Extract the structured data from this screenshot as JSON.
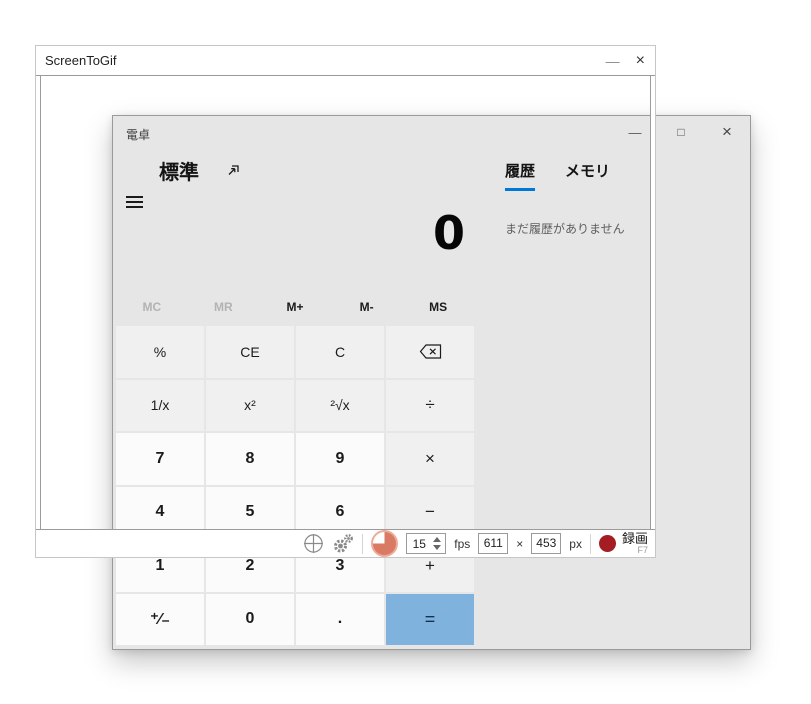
{
  "screentogif": {
    "title": "ScreenToGif",
    "controls": {
      "minimize": "—",
      "close": "×"
    },
    "toolbar": {
      "fps_value": "15",
      "fps_label": "fps",
      "width_value": "611",
      "dimension_separator": "×",
      "height_value": "453",
      "px_label": "px",
      "record_label": "録画",
      "record_shortcut": "F7"
    },
    "icons": {
      "crosshair": "crosshair-target-circle",
      "settings": "double-gears",
      "delay": "salmon-pie-three-quarters",
      "record": "dark-red-filled-dot"
    }
  },
  "calculator": {
    "title": "電卓",
    "controls": {
      "minimize": "—",
      "maximize": "□",
      "close": "×"
    },
    "mode_label": "標準",
    "icons": {
      "keep_on_top": "box-with-diagonal-arrow",
      "menu": "hamburger-three-lines",
      "backspace": "tag-with-x"
    },
    "tabs": [
      {
        "label": "履歴",
        "active": true
      },
      {
        "label": "メモリ",
        "active": false
      }
    ],
    "history_empty_text": "まだ履歴がありません",
    "display_value": "0",
    "memory_buttons": [
      {
        "label": "MC",
        "enabled": false
      },
      {
        "label": "MR",
        "enabled": false
      },
      {
        "label": "M+",
        "enabled": true
      },
      {
        "label": "M-",
        "enabled": true
      },
      {
        "label": "MS",
        "enabled": true
      }
    ],
    "keypad": [
      [
        "%",
        "CE",
        "C",
        "⌫"
      ],
      [
        "1/x",
        "x²",
        "²√x",
        "÷"
      ],
      [
        "7",
        "8",
        "9",
        "×"
      ],
      [
        "4",
        "5",
        "6",
        "−"
      ],
      [
        "1",
        "2",
        "3",
        "+"
      ],
      [
        "⁺⁄₋",
        "0",
        ".",
        "="
      ]
    ]
  },
  "colors": {
    "accent_blue": "#0078d7",
    "equals_button": "#7fb2dd",
    "record_red": "#a31d22",
    "delay_pie": "#d97a64",
    "calc_background": "#e6e6e6"
  }
}
